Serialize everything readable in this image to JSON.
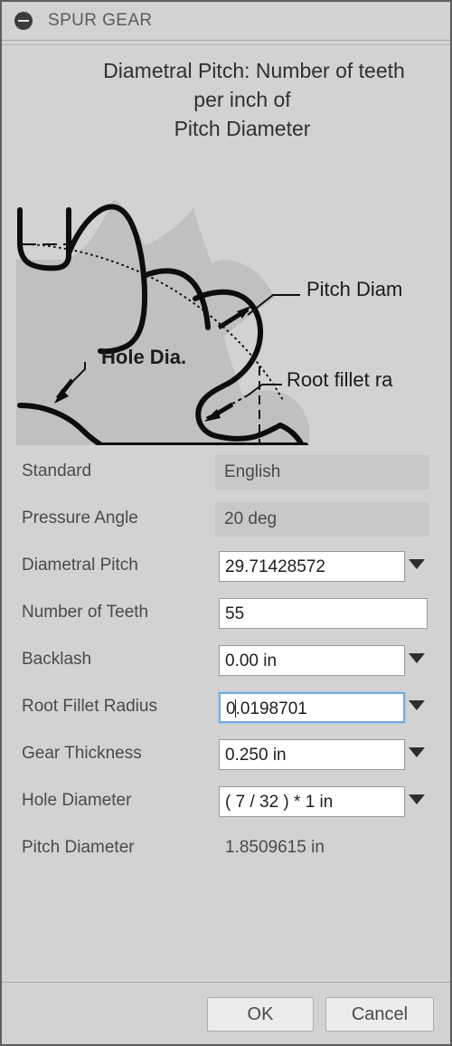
{
  "window": {
    "title": "SPUR GEAR",
    "collapse_icon": "minus-circle-icon"
  },
  "illustration": {
    "caption_line1": "Diametral Pitch: Number of teeth",
    "caption_line2": "per inch of",
    "caption_line3": "Pitch Diameter",
    "callouts": {
      "pitch_diameter": "Pitch Diam",
      "hole_dia": "Hole Dia.",
      "root_fillet": "Root fillet ra"
    },
    "colors": {
      "panel_bg": "#d2d2d2",
      "gear_body": "#c0c0c0",
      "outline": "#000000"
    }
  },
  "form": {
    "rows": [
      {
        "label": "Standard",
        "value": "English",
        "type": "combo-flat",
        "arrow": true,
        "focused": false
      },
      {
        "label": "Pressure Angle",
        "value": "20 deg",
        "type": "combo-flat",
        "arrow": true,
        "focused": false
      },
      {
        "label": "Diametral Pitch",
        "value": "29.71428572",
        "type": "textbox",
        "arrow": true,
        "focused": false
      },
      {
        "label": "Number of Teeth",
        "value": "55",
        "type": "textbox",
        "arrow": false,
        "focused": false
      },
      {
        "label": "Backlash",
        "value": "0.00 in",
        "type": "textbox",
        "arrow": true,
        "focused": false
      },
      {
        "label": "Root Fillet Radius",
        "value": "0.0198701",
        "type": "textbox",
        "arrow": true,
        "focused": true,
        "caret_after": 1
      },
      {
        "label": "Gear Thickness",
        "value": "0.250 in",
        "type": "textbox",
        "arrow": true,
        "focused": false
      },
      {
        "label": "Hole Diameter",
        "value": "( 7 / 32 ) * 1 in",
        "type": "textbox",
        "arrow": true,
        "focused": false
      },
      {
        "label": "Pitch Diameter",
        "value": "1.8509615 in",
        "type": "readonly",
        "arrow": false,
        "focused": false
      }
    ]
  },
  "footer": {
    "ok_label": "OK",
    "cancel_label": "Cancel"
  },
  "theme": {
    "accent_focus": "#76a9dd",
    "panel_bg": "#d2d2d2",
    "text": "#4a4a4a"
  }
}
